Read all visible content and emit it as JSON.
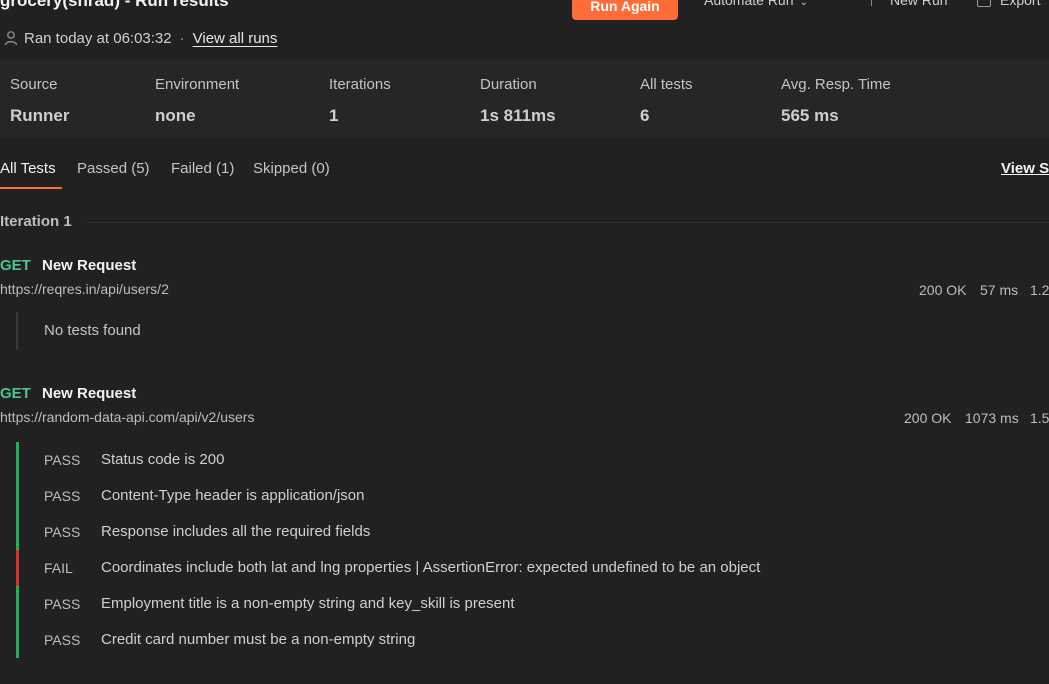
{
  "header": {
    "title": "grocery(shrad) - Run results",
    "run_again_label": "Run Again",
    "automate_label": "Automate Run",
    "new_run_label": "New Run",
    "export_label": "Export",
    "ran_text": "Ran today at 06:03:32",
    "separator": "·",
    "view_all_runs": "View all runs"
  },
  "stats": [
    {
      "label": "Source",
      "value": "Runner"
    },
    {
      "label": "Environment",
      "value": "none"
    },
    {
      "label": "Iterations",
      "value": "1"
    },
    {
      "label": "Duration",
      "value": "1s 811ms"
    },
    {
      "label": "All tests",
      "value": "6"
    },
    {
      "label": "Avg. Resp. Time",
      "value": "565 ms"
    }
  ],
  "tabs": [
    {
      "label": "All Tests",
      "active": true
    },
    {
      "label": "Passed (5)",
      "active": false
    },
    {
      "label": "Failed (1)",
      "active": false
    },
    {
      "label": "Skipped (0)",
      "active": false
    }
  ],
  "view_summary": "View S",
  "iteration_label": "Iteration 1",
  "requests": [
    {
      "method": "GET",
      "name": "New Request",
      "url": "https://reqres.in/api/users/2",
      "status": "200 OK",
      "time": "57 ms",
      "size": "1.2",
      "no_tests": "No tests found"
    },
    {
      "method": "GET",
      "name": "New Request",
      "url": "https://random-data-api.com/api/v2/users",
      "status": "200 OK",
      "time": "1073 ms",
      "size": "1.5",
      "tests": [
        {
          "result": "PASS",
          "name": "Status code is 200"
        },
        {
          "result": "PASS",
          "name": "Content-Type header is application/json"
        },
        {
          "result": "PASS",
          "name": "Response includes all the required fields"
        },
        {
          "result": "FAIL",
          "name": "Coordinates include both lat and lng properties | AssertionError: expected undefined to be an object"
        },
        {
          "result": "PASS",
          "name": "Employment title is a non-empty string and key_skill is present"
        },
        {
          "result": "PASS",
          "name": "Credit card number must be a non-empty string"
        }
      ]
    }
  ],
  "colors": {
    "accent": "#ff6c37",
    "method_get": "#53c28b",
    "pass": "#1fae5c",
    "fail": "#d83131"
  }
}
